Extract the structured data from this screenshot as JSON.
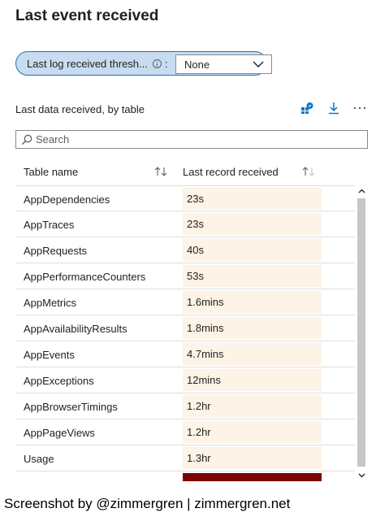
{
  "page": {
    "title": "Last event received"
  },
  "filter": {
    "label": "Last log received thresh...",
    "info_icon": "info-icon",
    "colon": ":",
    "selected": "None",
    "dropdown_icon": "chevron-down-icon"
  },
  "section": {
    "title": "Last data received, by table",
    "tools": [
      "pin-to-dashboard-icon",
      "download-icon",
      "more-icon"
    ]
  },
  "search": {
    "placeholder": "Search"
  },
  "table": {
    "columns": [
      {
        "label": "Table name"
      },
      {
        "label": "Last record received"
      }
    ],
    "rows": [
      {
        "name": "AppDependencies",
        "value": "23s"
      },
      {
        "name": "AppTraces",
        "value": "23s"
      },
      {
        "name": "AppRequests",
        "value": "40s"
      },
      {
        "name": "AppPerformanceCounters",
        "value": "53s"
      },
      {
        "name": "AppMetrics",
        "value": "1.6mins"
      },
      {
        "name": "AppAvailabilityResults",
        "value": "1.8mins"
      },
      {
        "name": "AppEvents",
        "value": "4.7mins"
      },
      {
        "name": "AppExceptions",
        "value": "12mins"
      },
      {
        "name": "AppBrowserTimings",
        "value": "1.2hr"
      },
      {
        "name": "AppPageViews",
        "value": "1.2hr"
      },
      {
        "name": "Usage",
        "value": "1.3hr"
      },
      {
        "name": "",
        "value": "",
        "hot": true
      }
    ],
    "colors": {
      "cell_fill": "#fdf3e6",
      "hot_fill": "#7a0000"
    }
  },
  "footer": {
    "text": "Screenshot by @zimmergren | zimmergren.net"
  }
}
